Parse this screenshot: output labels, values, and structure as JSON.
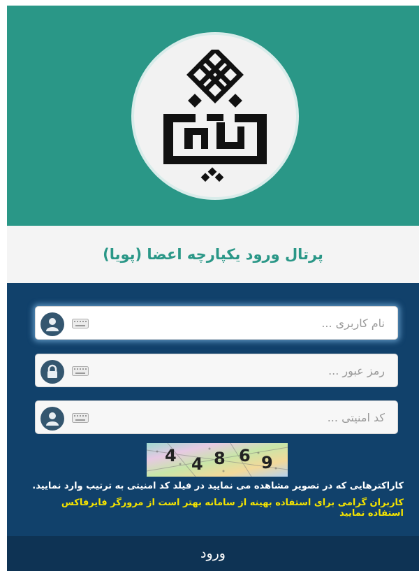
{
  "header": {
    "title": "پرتال ورود یکپارچه اعضا (پویا)",
    "logo": "university-logo",
    "colors": {
      "accent": "#2a9787",
      "form_bg": "#11416b",
      "button_bg": "#0e3354",
      "notice": "#f5e400"
    }
  },
  "form": {
    "username": {
      "placeholder": "نام کاربری ...",
      "icon": "user-icon",
      "value": ""
    },
    "password": {
      "placeholder": "رمز عبور ...",
      "icon": "lock-icon",
      "value": ""
    },
    "captcha_code": {
      "placeholder": "کد امنیتی ...",
      "icon": "user-icon",
      "value": ""
    },
    "captcha_text": "44869",
    "captcha_chars": [
      "4",
      "4",
      "8",
      "6",
      "9"
    ],
    "instruction": "کاراکترهایی که در تصویر مشاهده می نمایید در فیلد کد امنیتی به ترتیب وارد نمایید.",
    "browser_notice": "کاربران گرامی برای استفاده بهینه از سامانه بهتر است از مرورگر فایرفاکس استفاده نمایید",
    "submit_label": "ورود"
  }
}
